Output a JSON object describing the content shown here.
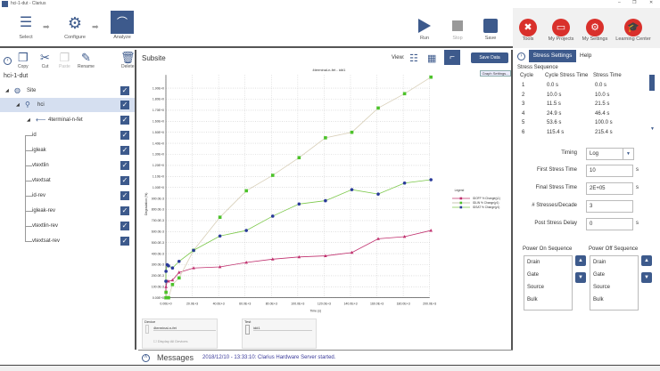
{
  "window": {
    "title": "hci-1-dut - Clarius",
    "controls": [
      "–",
      "❐",
      "✕"
    ]
  },
  "toolbar": {
    "steps": [
      {
        "label": "Select"
      },
      {
        "label": "Configure"
      },
      {
        "label": "Analyze"
      }
    ],
    "actions": [
      {
        "label": "Run"
      },
      {
        "label": "Stop"
      },
      {
        "label": "Save"
      }
    ],
    "links": [
      {
        "label": "Tools"
      },
      {
        "label": "My Projects"
      },
      {
        "label": "My Settings"
      },
      {
        "label": "Learning Center"
      }
    ]
  },
  "left": {
    "tools": [
      {
        "label": "Copy"
      },
      {
        "label": "Cut"
      },
      {
        "label": "Paste"
      },
      {
        "label": "Rename"
      },
      {
        "label": "Delete"
      }
    ],
    "project": "hci-1-dut",
    "tree": [
      {
        "label": "Site",
        "checked": true
      },
      {
        "label": "hci",
        "checked": true,
        "selected": true
      },
      {
        "label": "4terminal-n-fet",
        "checked": true
      },
      {
        "label": "id",
        "checked": true
      },
      {
        "label": "igleak",
        "checked": true
      },
      {
        "label": "vtextlin",
        "checked": true
      },
      {
        "label": "vtextsat",
        "checked": true
      },
      {
        "label": "id-rev",
        "checked": true
      },
      {
        "label": "igleak-rev",
        "checked": true
      },
      {
        "label": "vtextlin-rev",
        "checked": true
      },
      {
        "label": "vtextsat-rev",
        "checked": true
      }
    ]
  },
  "center": {
    "title": "Subsite",
    "view_label": "View:",
    "save_data": "Save Data",
    "graph_settings": "Graph Settings...",
    "device": {
      "label": "Device",
      "value": "4terminal-n-fet",
      "display_all": "Display All Devices"
    },
    "test": {
      "label": "Test",
      "value": "id#1"
    }
  },
  "chart_data": {
    "type": "line",
    "title": "4terminal-n-fet - id#1",
    "xlabel": "Time (s)",
    "ylabel": "Degradation (%)",
    "xlim": [
      0,
      200000
    ],
    "ylim": [
      0,
      2.02
    ],
    "xticks": [
      0,
      20000,
      40000,
      60000,
      80000,
      100000,
      120000,
      140000,
      160000,
      180000,
      200000
    ],
    "xtick_labels": [
      "0.00E+0",
      "20.0E+3",
      "40.0E+3",
      "60.0E+3",
      "80.0E+3",
      "100.0E+3",
      "120.0E+3",
      "140.0E+3",
      "160.0E+3",
      "180.0E+3",
      "200.0E+3"
    ],
    "yticks": [
      0,
      0.1,
      0.2,
      0.3,
      0.4,
      0.5,
      0.6,
      0.7,
      0.8,
      0.9,
      1.0,
      1.1,
      1.2,
      1.3,
      1.4,
      1.5,
      1.6,
      1.7,
      1.8,
      1.9
    ],
    "ytick_labels": [
      "0.00E+0",
      "100.0E-3",
      "200.0E-3",
      "300.0E-3",
      "400.0E-3",
      "500.0E-3",
      "600.0E-3",
      "700.0E-3",
      "800.0E-3",
      "900.0E-3",
      "1.00E+0",
      "1.10E+0",
      "1.20E+0",
      "1.30E+0",
      "1.40E+0",
      "1.50E+0",
      "1.60E+0",
      "1.70E+0",
      "1.80E+0",
      "1.90E+0"
    ],
    "grid": true,
    "legend_title": "Legend",
    "legend_position": "right",
    "series": [
      {
        "name": "IDOFF % Change(y1)",
        "color": "#c0306e",
        "line": "#c0306e",
        "marker": "triangle",
        "x": [
          10,
          100,
          1000,
          2000,
          5000,
          10000,
          21000,
          41000,
          61000,
          81000,
          101000,
          121000,
          141000,
          161000,
          181000,
          201000
        ],
        "y": [
          0.05,
          0.1,
          0.15,
          0.15,
          0.16,
          0.23,
          0.27,
          0.28,
          0.32,
          0.35,
          0.37,
          0.38,
          0.41,
          0.535,
          0.554,
          0.61
        ]
      },
      {
        "name": "IDLIN % Change(y1)",
        "color": "#4cc22a",
        "line": "#d8cfb8",
        "marker": "square",
        "x": [
          10,
          100,
          1000,
          2000,
          5000,
          10000,
          21000,
          41000,
          61000,
          81000,
          101000,
          121000,
          141000,
          161000,
          181000,
          201000
        ],
        "y": [
          0.0,
          0.05,
          0.0,
          0.0,
          0.12,
          0.18,
          0.43,
          0.73,
          0.97,
          1.11,
          1.27,
          1.45,
          1.5,
          1.72,
          1.85,
          2.0
        ]
      },
      {
        "name": "IDSAT % Change(y1)",
        "color": "#2a3a9a",
        "line": "#7cc84a",
        "marker": "circle",
        "x": [
          10,
          100,
          1000,
          2000,
          5000,
          10000,
          21000,
          41000,
          61000,
          81000,
          101000,
          121000,
          141000,
          161000,
          181000,
          201000
        ],
        "y": [
          0.15,
          0.24,
          0.3,
          0.29,
          0.27,
          0.33,
          0.43,
          0.56,
          0.61,
          0.74,
          0.85,
          0.88,
          0.98,
          0.94,
          1.04,
          1.07
        ]
      }
    ]
  },
  "messages": {
    "title": "Messages",
    "text": "2018/12/10 - 13:33:10: Clarius Hardware Server started."
  },
  "right": {
    "tabs": [
      {
        "label": "Stress Settings",
        "active": true
      },
      {
        "label": "Help"
      }
    ],
    "sequence_title": "Stress Sequence",
    "columns": [
      "Cycle",
      "Cycle Stress Time",
      "Stress Time"
    ],
    "rows": [
      [
        "1",
        "0.0 s",
        "0.0 s"
      ],
      [
        "2",
        "10.0 s",
        "10.0 s"
      ],
      [
        "3",
        "11.5 s",
        "21.5 s"
      ],
      [
        "4",
        "24.9 s",
        "46.4 s"
      ],
      [
        "5",
        "53.6 s",
        "100.0 s"
      ],
      [
        "6",
        "115.4 s",
        "215.4 s"
      ]
    ],
    "timing": {
      "label": "Timing",
      "value": "Log"
    },
    "first": {
      "label": "First Stress Time",
      "value": "10",
      "unit": "s"
    },
    "final": {
      "label": "Final Stress Time",
      "value": "2E+05",
      "unit": "s"
    },
    "per_decade": {
      "label": "# Stresses/Decade",
      "value": "3"
    },
    "delay": {
      "label": "Post Stress Delay",
      "value": "0",
      "unit": "s"
    },
    "power_on": {
      "label": "Power On Sequence",
      "items": [
        "Drain",
        "Gate",
        "Source",
        "Bulk"
      ]
    },
    "power_off": {
      "label": "Power Off Sequence",
      "items": [
        "Drain",
        "Gate",
        "Source",
        "Bulk"
      ]
    }
  }
}
